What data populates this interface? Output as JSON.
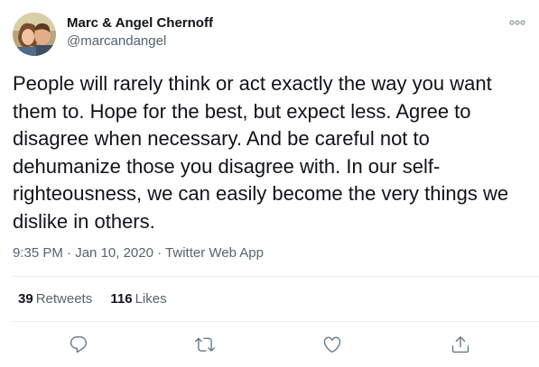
{
  "author": {
    "display_name": "Marc & Angel Chernoff",
    "handle": "@marcandangel"
  },
  "tweet": {
    "text": "People will rarely think or act exactly the way you want\nthem to. Hope for the best, but expect less. Agree to\ndisagree when necessary. And be careful not to\ndehumanize those you disagree with. In our self-\nrighteousness, we can easily become the very things we\ndislike in others."
  },
  "meta": {
    "time": "9:35 PM",
    "date": "Jan 10, 2020",
    "source": "Twitter Web App",
    "separator": "·"
  },
  "stats": {
    "retweets_count": "39",
    "retweets_label": "Retweets",
    "likes_count": "116",
    "likes_label": "Likes"
  },
  "icons": {
    "more": "more-icon",
    "reply": "reply-icon",
    "retweet": "retweet-icon",
    "like": "heart-icon",
    "share": "share-icon"
  },
  "colors": {
    "text": "#0f1419",
    "secondary": "#536471",
    "divider": "#e6ecf0"
  }
}
